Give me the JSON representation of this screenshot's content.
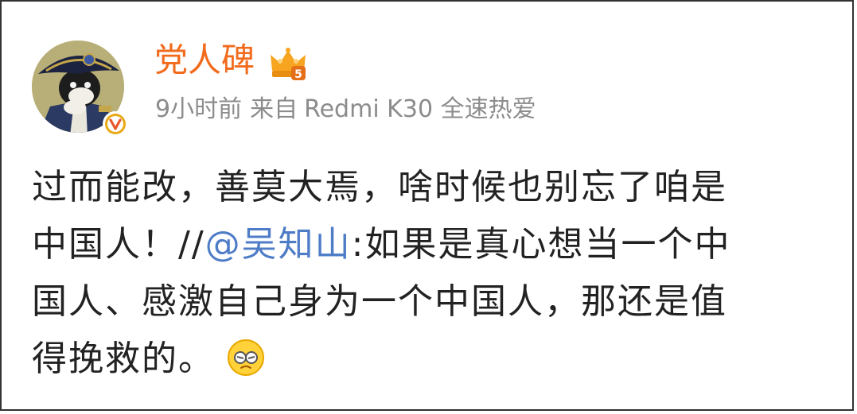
{
  "post": {
    "username": "党人碑",
    "time": "9小时前",
    "source_prefix": "来自",
    "device": "Redmi K30 全速热爱",
    "verified_icon": "verified-v-icon",
    "vip_icon": "crown-vip-icon",
    "vip_level": "5",
    "text_line1": "过而能改，善莫大焉，啥时候也别忘了咱是",
    "text_line2_start": "中国人！//",
    "mention": "@吴知山",
    "text_line2_end": ":如果是真心想当一个中",
    "text_line3": "国人、感激自己身为一个中国人，那还是值",
    "text_line4": "得挽救的。",
    "emoji": "facepalm-emoji"
  },
  "colors": {
    "username": "#f26b1d",
    "meta": "#8c8c8c",
    "text": "#222222",
    "mention": "#4e7cc7",
    "verified": "#e8a916"
  }
}
